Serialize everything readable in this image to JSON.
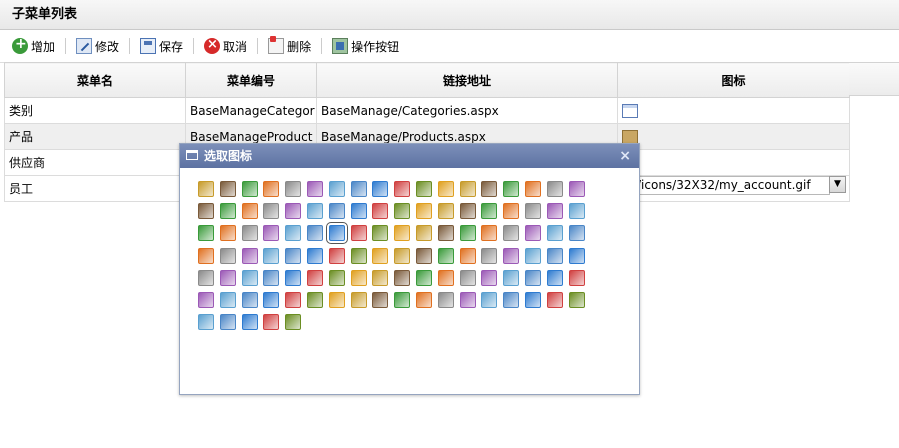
{
  "panel": {
    "title": "子菜单列表"
  },
  "toolbar": {
    "add": "增加",
    "edit": "修改",
    "save": "保存",
    "cancel": "取消",
    "delete": "删除",
    "actions": "操作按钮"
  },
  "grid": {
    "columns": [
      "菜单名",
      "菜单编号",
      "链接地址",
      "图标"
    ],
    "rows": [
      {
        "name": "类别",
        "code": "BaseManageCategor",
        "url": "BaseManage/Categories.aspx",
        "icon": "window-icon"
      },
      {
        "name": "产品",
        "code": "BaseManageProduct",
        "url": "BaseManage/Products.aspx",
        "icon": "box-icon"
      },
      {
        "name": "供应商",
        "code": "",
        "url": "",
        "icon": ""
      },
      {
        "name": "员工",
        "code": "",
        "url": "",
        "icon_value": "/icons/32X32/my_account.gif"
      }
    ]
  },
  "dialog": {
    "title": "选取图标",
    "close": "×",
    "icons": [
      [
        "contact-card",
        "notepad",
        "network",
        "sticky-note",
        "document",
        "bank",
        "basket",
        "award",
        "house",
        "mail-open",
        "forward",
        "pencil",
        "chart",
        "document-list",
        "stop",
        "grid",
        "folder",
        "check"
      ],
      [
        "clock",
        "globe",
        "chat",
        "puzzle",
        "tools",
        "refresh",
        "telephone",
        "link",
        "gear",
        "drive",
        "disc",
        "user-add",
        "edit-doc",
        "database",
        "money",
        "monitor",
        "copy",
        "heart-add"
      ],
      [
        "palette",
        "pencil2",
        "envelope",
        "bug",
        "rss",
        "rss2",
        "thumb-up",
        "flag",
        "folder2",
        "hand-point",
        "hand",
        "photo",
        "cd",
        "mouse",
        "heart",
        "briefcase",
        "home",
        "picture"
      ],
      [
        "export",
        "info",
        "calculator",
        "box-view",
        "lightbulb",
        "hourglass",
        "glasses",
        "lock",
        "login",
        "logout",
        "user-male",
        "sign",
        "id-card",
        "monitor2",
        "clipboard",
        "clipboard2",
        "clipboard3",
        "cards"
      ],
      [
        "paypal",
        "pen",
        "pen2",
        "phone",
        "layers",
        "plus",
        "star-folder",
        "printer",
        "pie",
        "pill",
        "package",
        "grid2",
        "chart-pie",
        "document2",
        "refresh2",
        "refresh3",
        "colors",
        "run"
      ],
      [
        "search",
        "zoom",
        "gear2",
        "tools2",
        "download",
        "film",
        "arrow-right",
        "arrow-left",
        "upload",
        "sitemap",
        "hand2",
        "star",
        "bag",
        "image-doc",
        "tag",
        "ruler",
        "time",
        "flag2"
      ],
      [
        "twitter",
        "document3",
        "person",
        "globe2",
        "zoom-in"
      ]
    ]
  },
  "colors": {
    "dialog_header": "#6a7fae",
    "alt_row": "#efefef"
  }
}
